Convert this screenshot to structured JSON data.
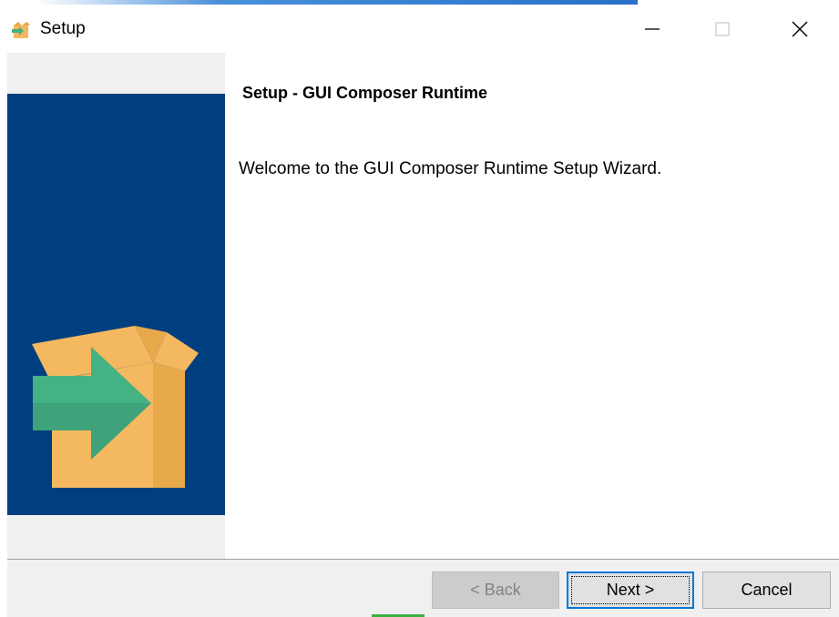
{
  "window": {
    "title": "Setup",
    "controls": {
      "minimize_icon": "minimize-icon",
      "maximize_icon": "maximize-icon",
      "close_icon": "close-icon"
    }
  },
  "content": {
    "heading": "Setup - GUI Composer Runtime",
    "welcome_text": "Welcome to the GUI Composer Runtime Setup Wizard."
  },
  "buttons": {
    "back_label": "< Back",
    "next_label": "Next >",
    "cancel_label": "Cancel"
  },
  "colors": {
    "side_panel_blue": "#003f7f",
    "box_yellow": "#f4b860",
    "arrow_green": "#44b283",
    "focus_blue": "#0078d7"
  }
}
